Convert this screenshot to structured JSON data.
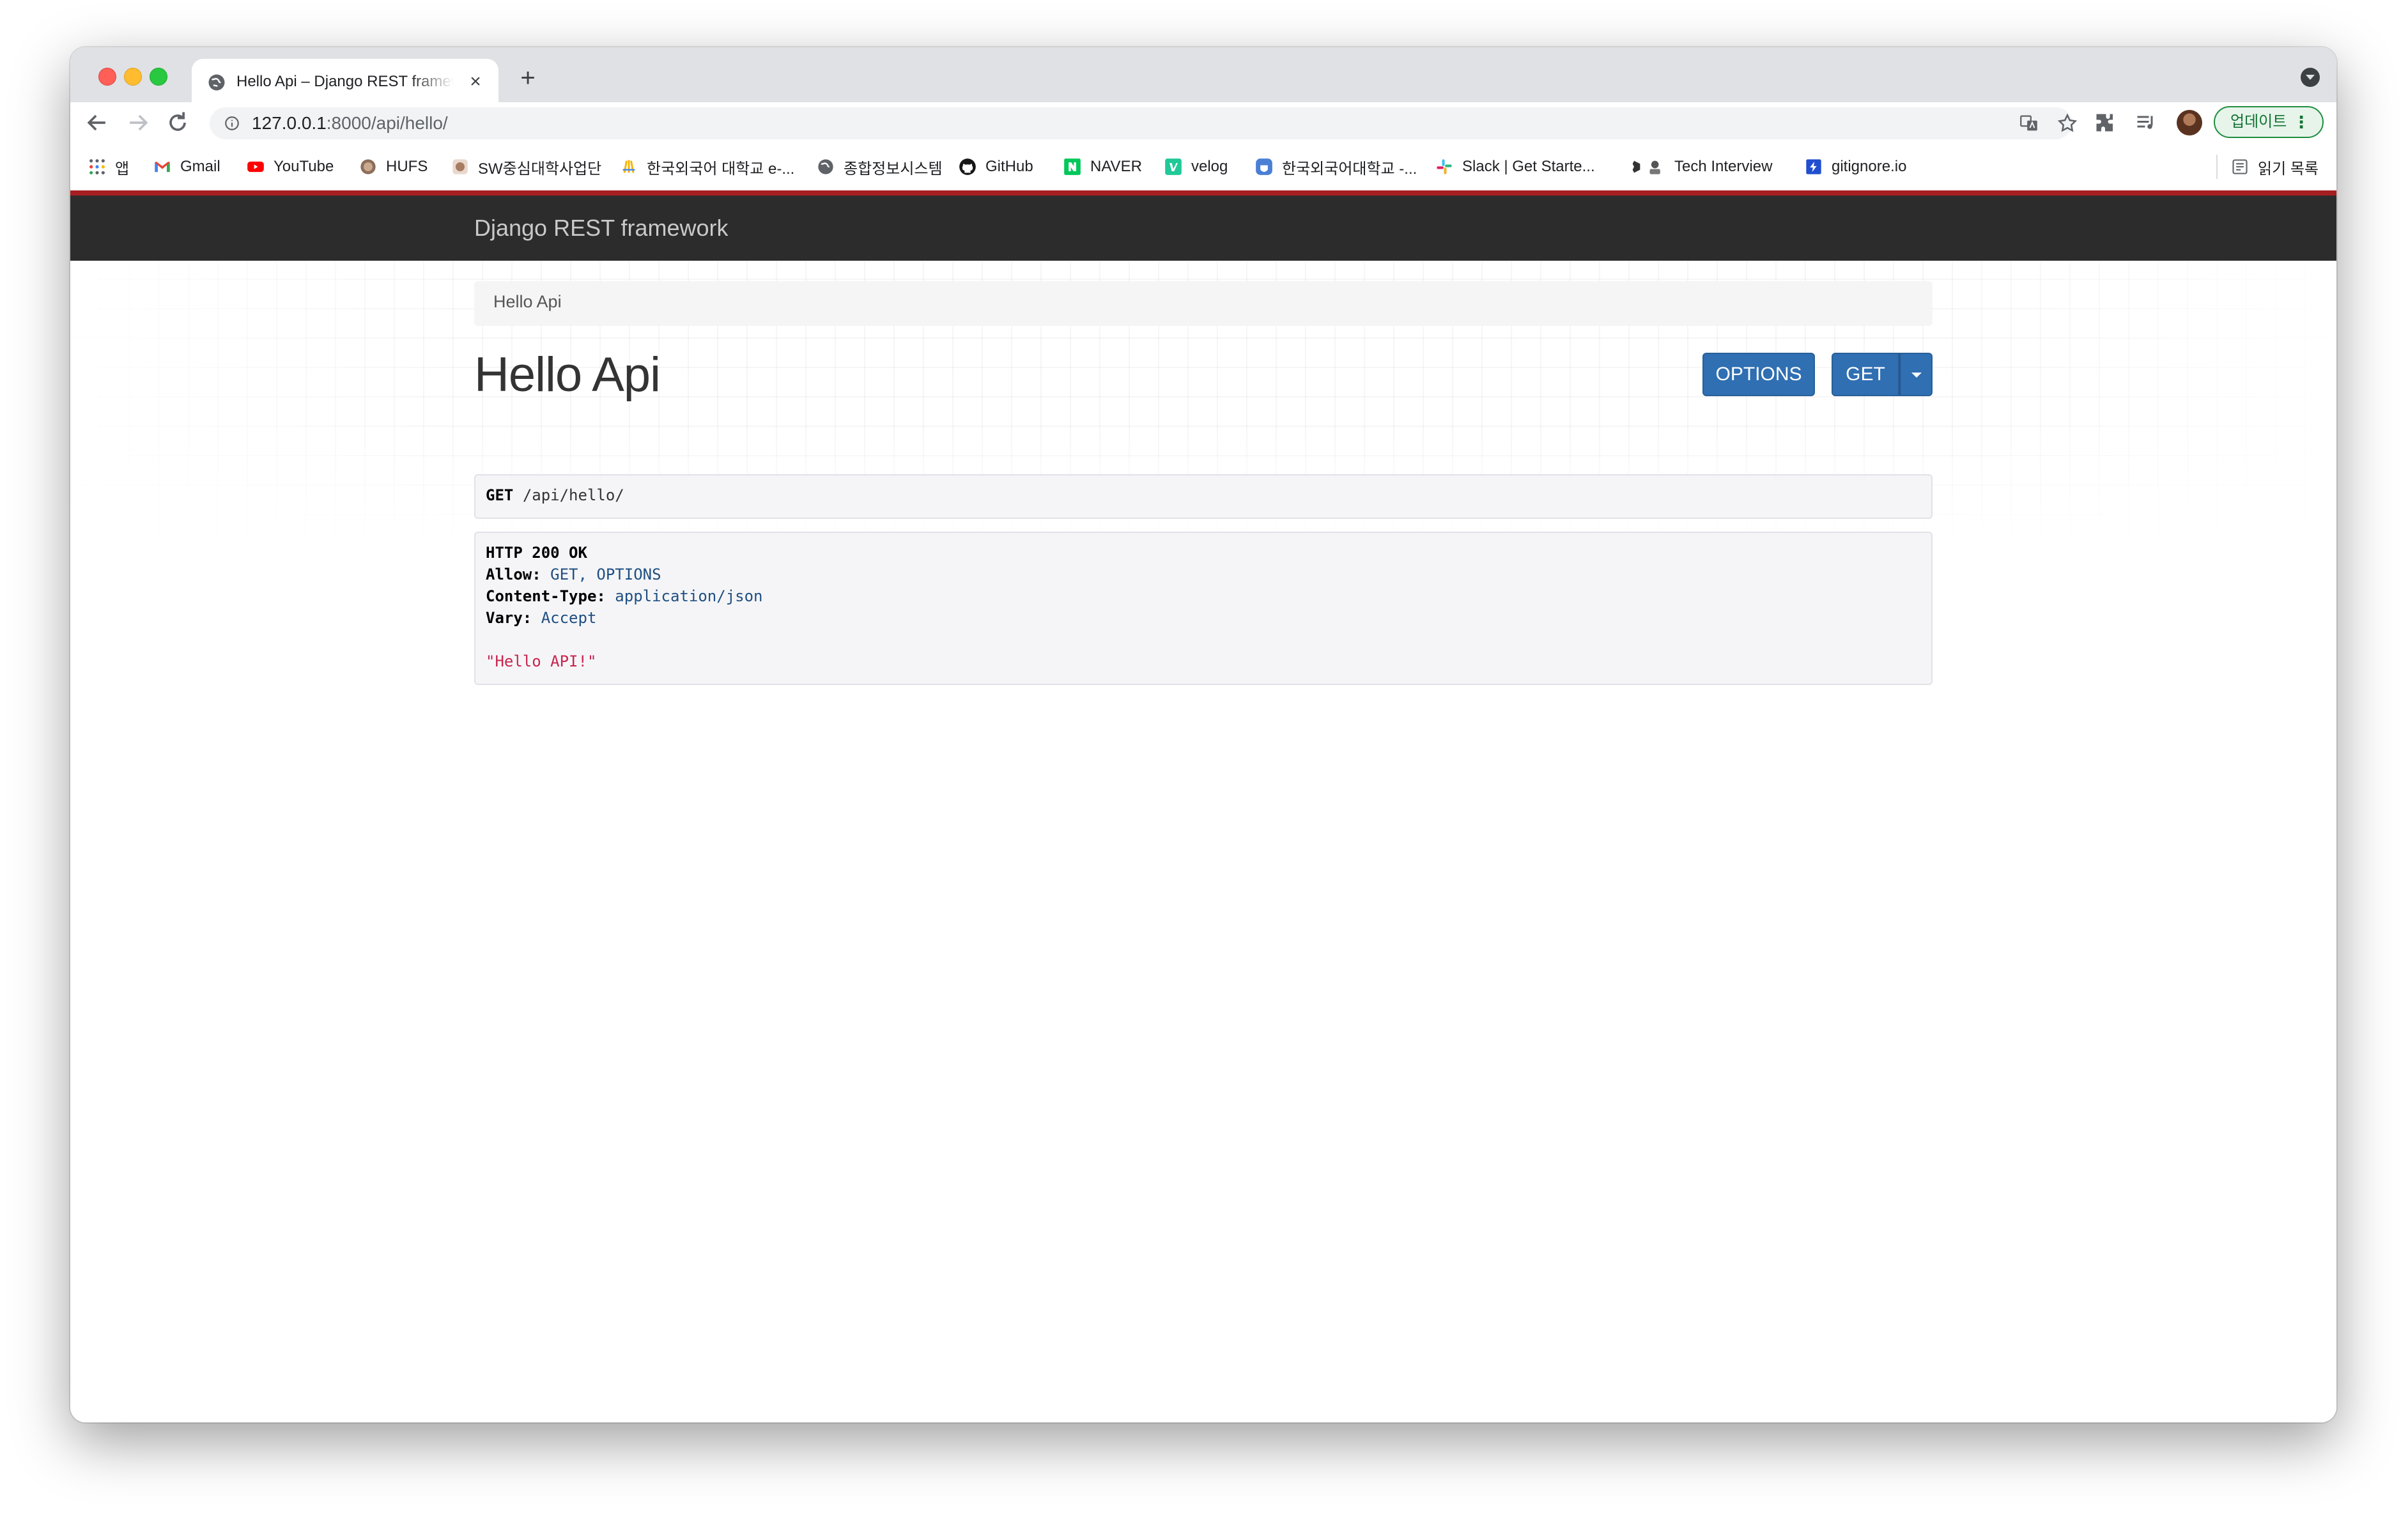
{
  "browser": {
    "tab_title": "Hello Api – Django REST framework",
    "new_tab_label": "+",
    "tab_close_label": "×",
    "url_host": "127.0.0.1",
    "url_rest": ":8000/api/hello/",
    "update_label": "업데이트",
    "update_menu": "⋮",
    "bookmarks": [
      {
        "label": "앱",
        "icon": "apps-grid-icon"
      },
      {
        "label": "Gmail",
        "icon": "gmail-icon"
      },
      {
        "label": "YouTube",
        "icon": "youtube-icon"
      },
      {
        "label": "HUFS",
        "icon": "hufs-icon"
      },
      {
        "label": "SW중심대학사업단",
        "icon": "sw-icon"
      },
      {
        "label": "한국외국어 대학교 e-...",
        "icon": "hufs-eclass-icon"
      },
      {
        "label": "종합정보시스템",
        "icon": "globe-icon"
      },
      {
        "label": "GitHub",
        "icon": "github-icon"
      },
      {
        "label": "NAVER",
        "icon": "naver-icon"
      },
      {
        "label": "velog",
        "icon": "velog-icon"
      },
      {
        "label": "한국외국어대학교 -...",
        "icon": "hufs-shield-icon"
      },
      {
        "label": "Slack | Get Starte...",
        "icon": "slack-icon"
      },
      {
        "label": "Tech Interview",
        "icon": "tech-interview-icon"
      },
      {
        "label": "gitignore.io",
        "icon": "gitignore-icon"
      }
    ],
    "reading_list_label": "읽기 목록"
  },
  "drf": {
    "brand": "Django REST framework",
    "breadcrumb": "Hello Api",
    "title": "Hello Api",
    "options_label": "OPTIONS",
    "get_label": "GET",
    "request": {
      "method": "GET",
      "path": "/api/hello/"
    },
    "response": {
      "status": "HTTP 200 OK",
      "headers": [
        {
          "name": "Allow:",
          "value": "GET, OPTIONS"
        },
        {
          "name": "Content-Type:",
          "value": "application/json"
        },
        {
          "name": "Vary:",
          "value": "Accept"
        }
      ],
      "body": "\"Hello API!\""
    }
  },
  "colors": {
    "navbar": "#2c2c2c",
    "accent_bar": "#a61e22",
    "primary_button": "#2f6fb2",
    "json_string": "#c7254e"
  }
}
